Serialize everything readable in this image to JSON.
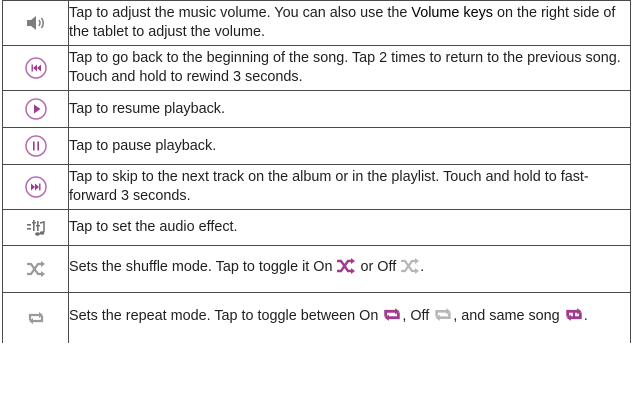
{
  "rows": [
    {
      "icon": "volume-icon",
      "text": "Tap to adjust the music volume. You can also use the ",
      "bold": "Volume keys",
      "text_after": " on the right side of the tablet to adjust the volume."
    },
    {
      "icon": "rewind-icon",
      "text": "Tap to go back to the beginning of the song. Tap 2 times to return to the previous song. Touch and hold to rewind 3 seconds."
    },
    {
      "icon": "play-icon",
      "text": "Tap to resume playback."
    },
    {
      "icon": "pause-icon",
      "text": "Tap to pause playback."
    },
    {
      "icon": "fast-forward-icon",
      "text": "Tap to skip to the next track on the album or in the playlist. Touch and hold to fast-forward 3 seconds."
    },
    {
      "icon": "audio-effect-icon",
      "text": "Tap to set the audio effect."
    },
    {
      "icon": "shuffle-icon",
      "text_1": "Sets the shuffle mode. Tap to toggle it On ",
      "text_2": " or Off ",
      "text_3": "."
    },
    {
      "icon": "repeat-icon",
      "text_1": "Sets the repeat mode. Tap to toggle between On ",
      "text_2": ", Off ",
      "text_3": ", and same song ",
      "text_4": "."
    }
  ],
  "colors": {
    "accent": "#a23b8f",
    "icon_gray": "#9a9a9a",
    "border": "#4a4a4a"
  }
}
